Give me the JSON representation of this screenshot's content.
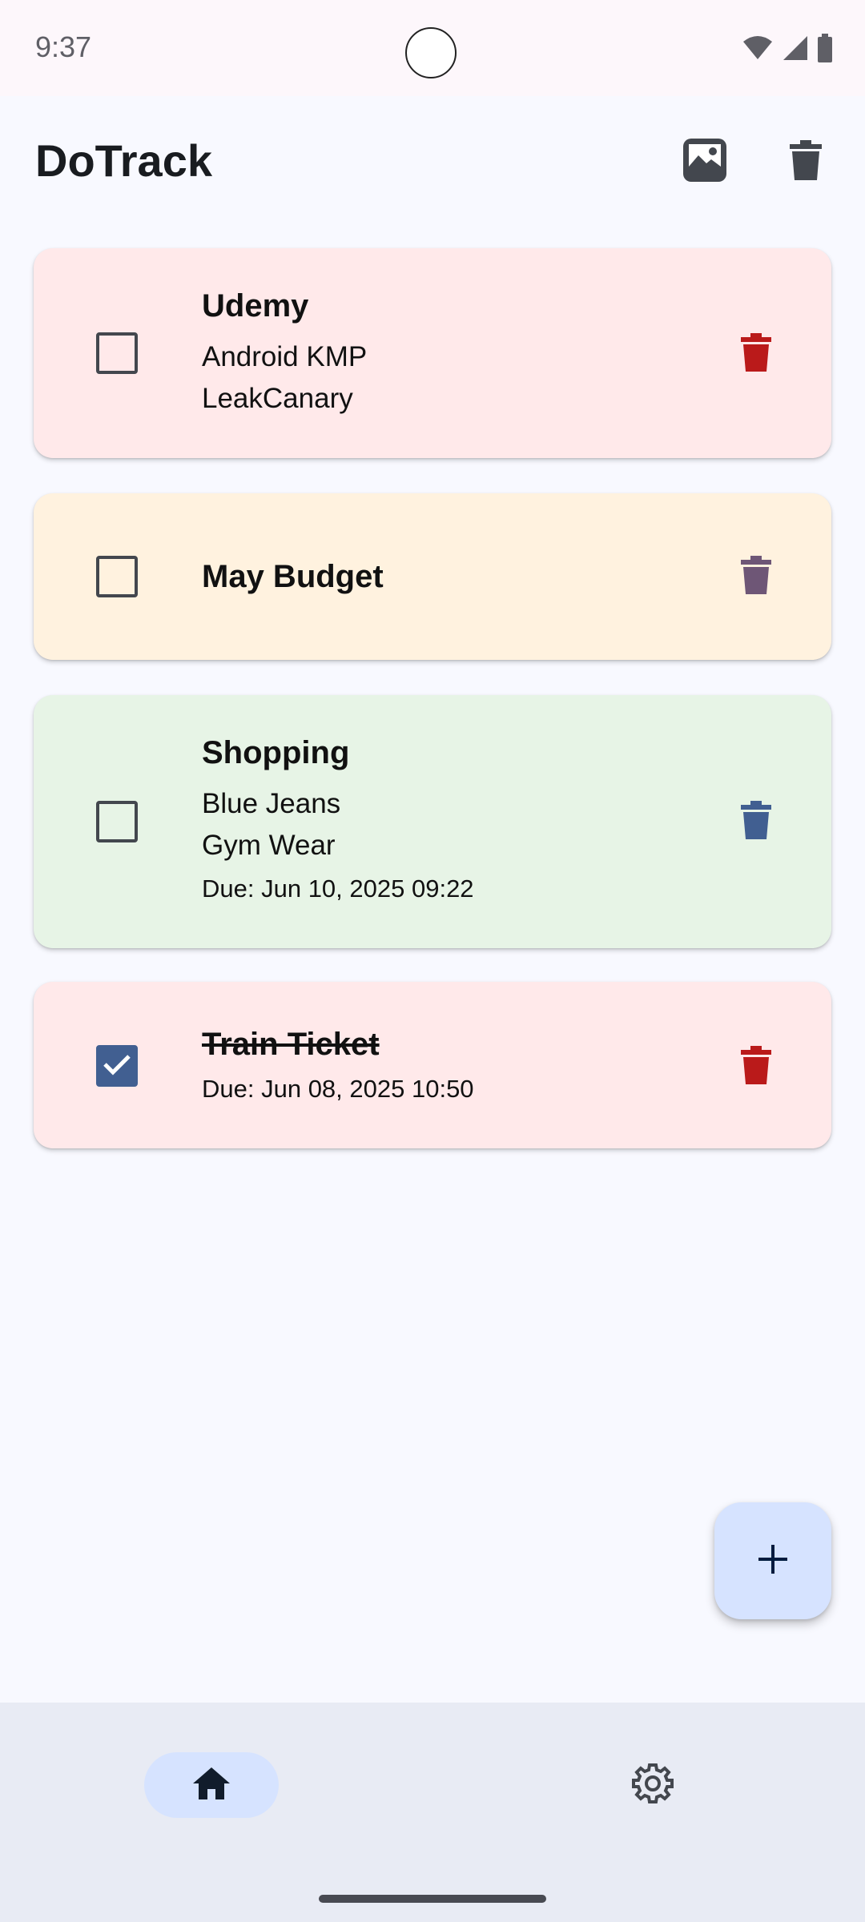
{
  "status_bar": {
    "time": "9:37",
    "icons": [
      "wifi-icon",
      "signal-icon",
      "battery-icon"
    ]
  },
  "app_bar": {
    "title": "DoTrack",
    "actions": [
      "image-icon",
      "delete-all-icon"
    ]
  },
  "todos": [
    {
      "title": "Udemy",
      "lines": [
        "Android KMP",
        "LeakCanary"
      ],
      "due": "",
      "checked": false,
      "background": "#ffe9ea",
      "delete_color": "#ba1a1a"
    },
    {
      "title": "May Budget",
      "lines": [],
      "due": "",
      "checked": false,
      "background": "#fff2df",
      "delete_color": "#6e5676"
    },
    {
      "title": "Shopping",
      "lines": [
        "Blue Jeans",
        "Gym Wear"
      ],
      "due": "Due: Jun 10, 2025 09:22",
      "checked": false,
      "background": "#e7f4e6",
      "delete_color": "#415f91"
    },
    {
      "title": "Train Ticket",
      "lines": [],
      "due": "Due: Jun 08, 2025 10:50",
      "checked": true,
      "background": "#ffe9ea",
      "delete_color": "#ba1a1a"
    }
  ],
  "fab": {
    "icon": "plus-icon"
  },
  "bottom_nav": {
    "items": [
      {
        "icon": "home-icon",
        "selected": true
      },
      {
        "icon": "settings-icon",
        "selected": false
      }
    ]
  },
  "colors": {
    "primary": "#415f91",
    "primary_container": "#d6e3ff",
    "background": "#f8f9ff",
    "nav_background": "#e8ebf4"
  }
}
